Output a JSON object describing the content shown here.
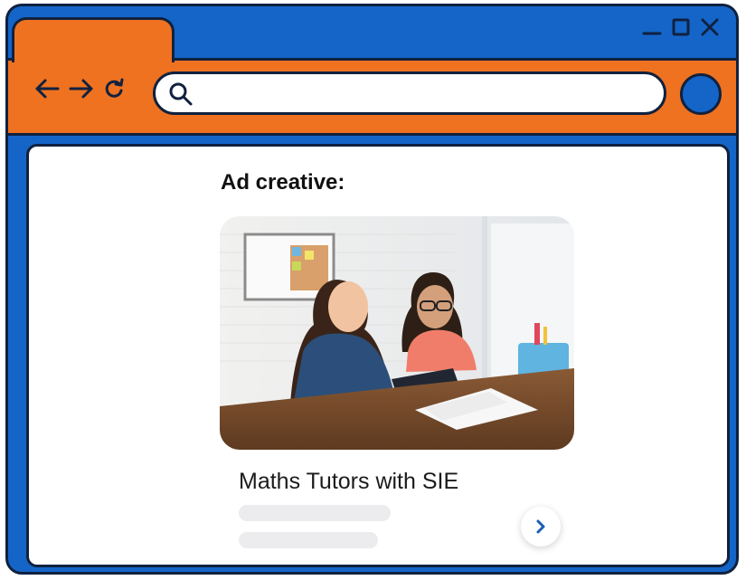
{
  "browser": {
    "controls": {
      "minimize_icon": "minimize-icon",
      "maximize_icon": "maximize-icon",
      "close_icon": "close-icon"
    },
    "nav": {
      "back_icon": "arrow-left-icon",
      "forward_icon": "arrow-right-icon",
      "reload_icon": "reload-icon"
    },
    "search_icon": "search-icon",
    "url_value": "",
    "colors": {
      "frame_blue": "#1565c8",
      "tab_orange": "#ee7220",
      "outline": "#10213f"
    }
  },
  "content": {
    "heading": "Ad creative:",
    "ad": {
      "image_alt": "Tutor and girl reading a book at a table",
      "title": "Maths Tutors with SIE",
      "next_icon": "chevron-right-icon"
    }
  }
}
